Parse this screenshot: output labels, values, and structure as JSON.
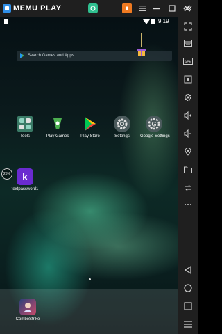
{
  "titlebar": {
    "app_name": "MEMU PLAY",
    "buttons": [
      "menu",
      "minimize",
      "maximize",
      "close",
      "collapse-sidebar"
    ]
  },
  "statusbar": {
    "time": "9:19"
  },
  "search": {
    "placeholder": "Search Games and Apps"
  },
  "home": {
    "apps": [
      {
        "label": "Tools"
      },
      {
        "label": "Play Games"
      },
      {
        "label": "Play Store"
      },
      {
        "label": "Settings"
      },
      {
        "label": "Google Settings"
      }
    ],
    "downloading_app": {
      "label": "textpassword1",
      "progress_text": "25%"
    }
  },
  "dock": {
    "apps": [
      {
        "label": "ComboStrike"
      }
    ]
  },
  "colors": {
    "titlebar": "#1f1f1f",
    "accent": "#2f8fe8",
    "wallpaper_glow": "#5fdcaa"
  }
}
